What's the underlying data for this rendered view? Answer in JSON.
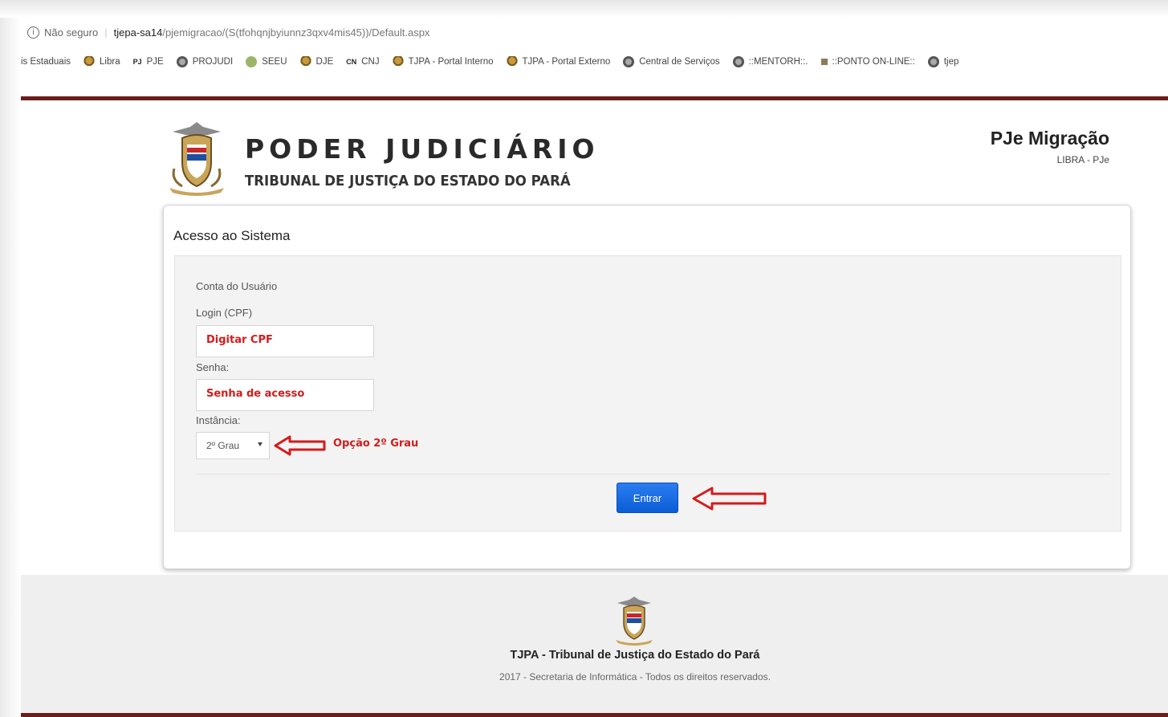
{
  "browser": {
    "security_label": "Não seguro",
    "url_host": "tjepa-sa14",
    "url_path": "/pjemigracao/(S(tfohqnjbyiunnz3qxv4mis45))/Default.aspx",
    "bookmarks": [
      {
        "label": "is Estaduais",
        "icon": "none"
      },
      {
        "label": "Libra",
        "icon": "crest-icon"
      },
      {
        "label": "PJE",
        "icon": "pje-icon"
      },
      {
        "label": "PROJUDI",
        "icon": "globe-icon"
      },
      {
        "label": "SEEU",
        "icon": "seeu-icon"
      },
      {
        "label": "DJE",
        "icon": "crest-icon"
      },
      {
        "label": "CNJ",
        "icon": "cnj-icon"
      },
      {
        "label": "TJPA - Portal Interno",
        "icon": "crest-icon"
      },
      {
        "label": "TJPA - Portal Externo",
        "icon": "crest-icon"
      },
      {
        "label": "Central de Serviços",
        "icon": "globe-icon"
      },
      {
        "label": "::MENTORH::.",
        "icon": "globe-icon"
      },
      {
        "label": "::PONTO ON-LINE::",
        "icon": "bookmark-icon"
      },
      {
        "label": "tjep",
        "icon": "globe-icon"
      }
    ]
  },
  "header": {
    "brand_title": "PODER JUDICIÁRIO",
    "brand_subtitle": "TRIBUNAL DE JUSTIÇA DO ESTADO DO PARÁ",
    "app_title": "PJe Migração",
    "app_subtitle": "LIBRA - PJe"
  },
  "login": {
    "card_title": "Acesso ao Sistema",
    "section_label": "Conta do Usuário",
    "login_label": "Login (CPF)",
    "login_value": "Digitar CPF",
    "password_label": "Senha:",
    "password_value": "Senha de acesso",
    "instance_label": "Instância:",
    "instance_selected": "2º Grau",
    "instance_annotation": "Opção 2º Grau",
    "submit_label": "Entrar"
  },
  "footer": {
    "title": "TJPA - Tribunal de Justiça do Estado do Pará",
    "copyright": "2017 - Secretaria de Informática - Todos os direitos reservados."
  },
  "colors": {
    "accent_red": "#d21c1c",
    "header_bar": "#6b1d1d",
    "button_blue": "#0b5dd6"
  }
}
